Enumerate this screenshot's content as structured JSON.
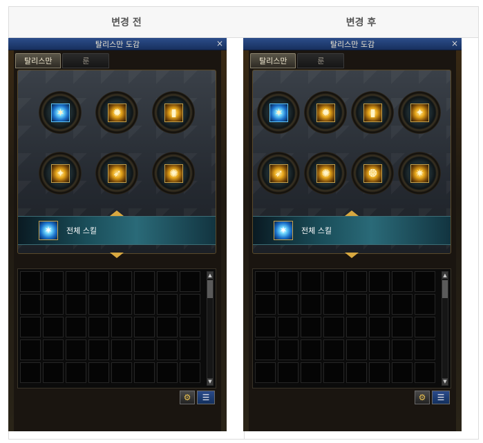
{
  "columns": {
    "before": "변경 전",
    "after": "변경 후"
  },
  "window": {
    "title": "탈리스만 도감",
    "close": "×"
  },
  "tabs": {
    "talisman": "탈리스만",
    "rune": "룬"
  },
  "banner": {
    "label": "전체 스킬",
    "icon": "skill-all-icon"
  },
  "buttons": {
    "gear": "⚙",
    "list": "☰"
  },
  "scroll": {
    "up": "▲",
    "down": "▼"
  },
  "before_icons": [
    {
      "icon": "blue-burst-icon",
      "glyph": "✶"
    },
    {
      "icon": "gold-explosion-icon",
      "glyph": "✹"
    },
    {
      "icon": "gold-pillars-icon",
      "glyph": "▮"
    },
    {
      "icon": "gold-shards-icon",
      "glyph": "✦"
    },
    {
      "icon": "gold-wing-icon",
      "glyph": "➶"
    },
    {
      "icon": "gold-beam-icon",
      "glyph": "✺"
    }
  ],
  "after_icons": [
    {
      "icon": "blue-burst-icon",
      "glyph": "✶"
    },
    {
      "icon": "gold-explosion-icon",
      "glyph": "✹"
    },
    {
      "icon": "gold-pillars-icon",
      "glyph": "▮"
    },
    {
      "icon": "gold-shards-icon",
      "glyph": "✦"
    },
    {
      "icon": "gold-wing-icon",
      "glyph": "➶"
    },
    {
      "icon": "gold-beam-icon",
      "glyph": "✺"
    },
    {
      "icon": "gold-swirl-icon",
      "glyph": "❂"
    },
    {
      "icon": "gold-flare-icon",
      "glyph": "✷"
    }
  ],
  "colors": {
    "accent_gold": "#c9a24a",
    "title_blue": "#2c4d8a",
    "banner_teal": "#2a6a78"
  }
}
